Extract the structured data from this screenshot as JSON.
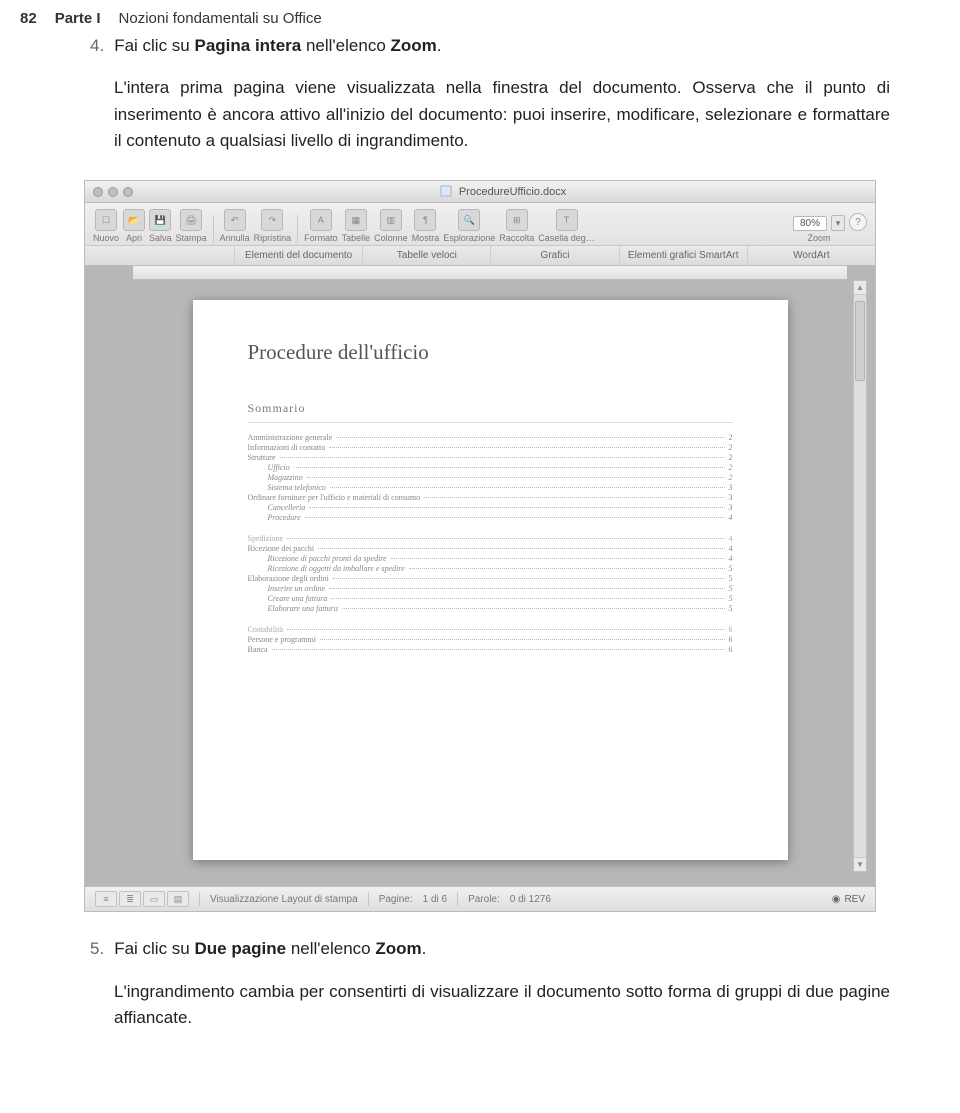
{
  "header": {
    "page_number": "82",
    "part": "Parte I",
    "part_title": "Nozioni fondamentali su Office"
  },
  "step4": {
    "num": "4.",
    "pre": "Fai clic su ",
    "bold1": "Pagina intera",
    "mid": " nell'elenco ",
    "bold2": "Zoom",
    "post": "."
  },
  "para1": "L'intera prima pagina viene visualizzata nella finestra del documento. Osserva che il punto di inserimento è ancora attivo all'inizio del documento: puoi inserire, modificare, selezionare e formattare il contenuto a qualsiasi livello di ingrandimento.",
  "app": {
    "doc_name": "ProcedureUfficio.docx",
    "zoom_value": "80%",
    "zoom_label": "Zoom",
    "help": "?",
    "toolbar": [
      "Nuovo",
      "Apri",
      "Salva",
      "Stampa",
      "Annulla",
      "Ripristina",
      "Formato",
      "Tabelle",
      "Colonne",
      "Mostra",
      "Esplorazione",
      "Raccolta",
      "Casella deg…"
    ],
    "tabs": [
      "Elementi del documento",
      "Tabelle veloci",
      "Grafici",
      "Elementi grafici SmartArt",
      "WordArt"
    ],
    "doc_title": "Procedure dell'ufficio",
    "sommario": "Sommario",
    "toc": [
      {
        "label": "Amministrazione generale",
        "page": "2",
        "lvl": 1
      },
      {
        "label": "Informazioni di contatto",
        "page": "2",
        "lvl": 1
      },
      {
        "label": "Strutture",
        "page": "2",
        "lvl": 1
      },
      {
        "label": "Ufficio",
        "page": "2",
        "lvl": 2
      },
      {
        "label": "Magazzino",
        "page": "2",
        "lvl": 2
      },
      {
        "label": "Sistema telefonico",
        "page": "3",
        "lvl": 2
      },
      {
        "label": "Ordinare forniture per l'ufficio e materiali di consumo",
        "page": "3",
        "lvl": 1
      },
      {
        "label": "Cancelleria",
        "page": "3",
        "lvl": 2
      },
      {
        "label": "Procedure",
        "page": "4",
        "lvl": 2
      },
      {
        "label": "Spedizione",
        "page": "4",
        "lvl": 1,
        "spaced": true
      },
      {
        "label": "Ricezione dei pacchi",
        "page": "4",
        "lvl": 1
      },
      {
        "label": "Ricezione di pacchi pronti da spedire",
        "page": "4",
        "lvl": 2
      },
      {
        "label": "Ricezione di oggetti da imballare e spedire",
        "page": "5",
        "lvl": 2
      },
      {
        "label": "Elaborazione degli ordini",
        "page": "5",
        "lvl": 1
      },
      {
        "label": "Inserire un ordine",
        "page": "5",
        "lvl": 2
      },
      {
        "label": "Creare una fattura",
        "page": "5",
        "lvl": 2
      },
      {
        "label": "Elaborare una fattura",
        "page": "5",
        "lvl": 2
      },
      {
        "label": "Contabilità",
        "page": "6",
        "lvl": 1,
        "spaced": true
      },
      {
        "label": "Persone e programmi",
        "page": "6",
        "lvl": 1
      },
      {
        "label": "Banca",
        "page": "6",
        "lvl": 1
      }
    ],
    "status": {
      "view_label": "Visualizzazione Layout di stampa",
      "pages_label": "Pagine:",
      "pages_value": "1 di 6",
      "words_label": "Parole:",
      "words_value": "0 di 1276",
      "rev": "REV"
    }
  },
  "step5": {
    "num": "5.",
    "pre": "Fai clic su ",
    "bold1": "Due pagine",
    "mid": " nell'elenco ",
    "bold2": "Zoom",
    "post": "."
  },
  "para2": "L'ingrandimento cambia per consentirti di visualizzare il documento sotto forma di gruppi di due pagine affiancate."
}
